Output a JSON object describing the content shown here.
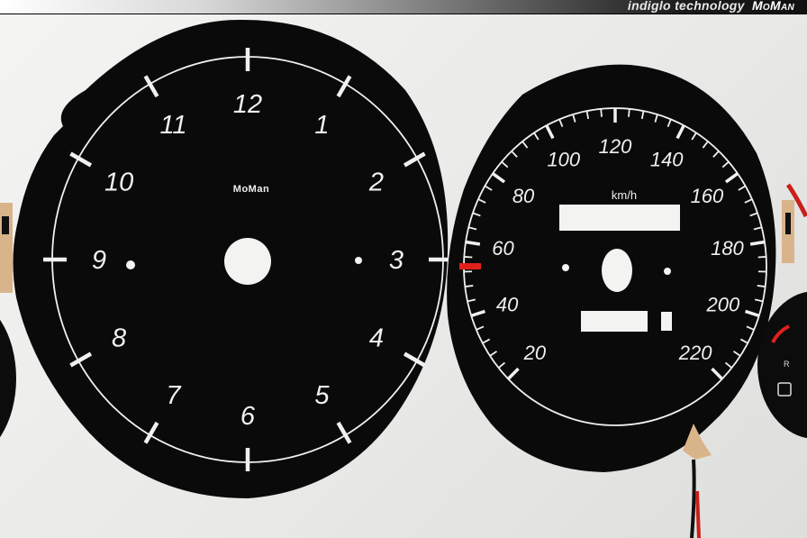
{
  "header": {
    "tagline": "indiglo technology",
    "logo": "MoMan"
  },
  "clock_dial": {
    "logo": "MoMan",
    "numerals": [
      "12",
      "1",
      "2",
      "3",
      "4",
      "5",
      "6",
      "7",
      "8",
      "9",
      "10",
      "11"
    ]
  },
  "speedometer": {
    "unit": "km/h",
    "labels": [
      "20",
      "40",
      "60",
      "80",
      "100",
      "120",
      "140",
      "160",
      "180",
      "200",
      "220"
    ],
    "redline_marker_color": "#e0201a"
  },
  "colors": {
    "dial_face": "#0a0a0a",
    "markings": "#f0f0f0",
    "background": "#ececea",
    "wire_red": "#c8201a"
  }
}
